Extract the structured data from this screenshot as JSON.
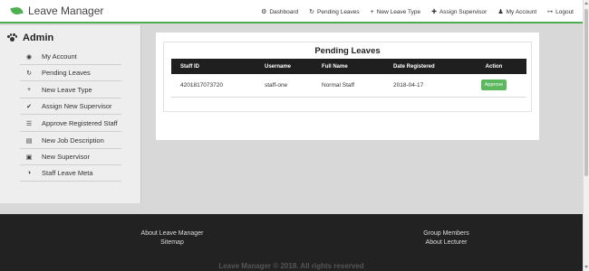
{
  "brand": "Leave Manager",
  "nav": [
    {
      "label": "Dashboard",
      "icon": "dashboard-icon",
      "glyph": "⚙"
    },
    {
      "label": "Pending Leaves",
      "icon": "refresh-icon",
      "glyph": "↻"
    },
    {
      "label": "New Leave Type",
      "icon": "plus-icon",
      "glyph": "+"
    },
    {
      "label": "Assign Supervisor",
      "icon": "plus-icon",
      "glyph": "✚"
    },
    {
      "label": "My Account",
      "icon": "user-icon",
      "glyph": "♟"
    },
    {
      "label": "Logout",
      "icon": "logout-icon",
      "glyph": "↦"
    }
  ],
  "sidebar": {
    "title": "Admin",
    "items": [
      {
        "label": "My Account",
        "icon": "user-circle-icon",
        "glyph": "◉"
      },
      {
        "label": "Pending Leaves",
        "icon": "refresh-icon",
        "glyph": "↻"
      },
      {
        "label": "New Leave Type",
        "icon": "plus-icon",
        "glyph": "+"
      },
      {
        "label": "Assign New Supervisor",
        "icon": "check-icon",
        "glyph": "✔"
      },
      {
        "label": "Approve Registered Staff",
        "icon": "list-icon",
        "glyph": "☰"
      },
      {
        "label": "New Job Description",
        "icon": "briefcase-icon",
        "glyph": "▤"
      },
      {
        "label": "New Supervisor",
        "icon": "id-card-icon",
        "glyph": "▣"
      },
      {
        "label": "Staff Leave Meta",
        "icon": "half-circle-icon",
        "glyph": "◑"
      }
    ]
  },
  "main": {
    "title": "Pending Leaves",
    "columns": [
      "Staff ID",
      "Username",
      "Full Name",
      "Date Registered",
      "Action"
    ],
    "rows": [
      {
        "staff_id": "4201817073720",
        "username": "staff-one",
        "full_name": "Normal Staff",
        "date": "2018-04-17",
        "action": "Approve"
      }
    ]
  },
  "footer": {
    "left_links": [
      "About Leave Manager",
      "Sitemap"
    ],
    "right_links": [
      "Group Members",
      "About Lecturer"
    ],
    "copyright": "Leave Manager © 2018. All rights reserved"
  },
  "colors": {
    "accent": "#4caf50",
    "approve": "#5cb85c",
    "table_header": "#1f1f1f",
    "footer": "#222222"
  }
}
